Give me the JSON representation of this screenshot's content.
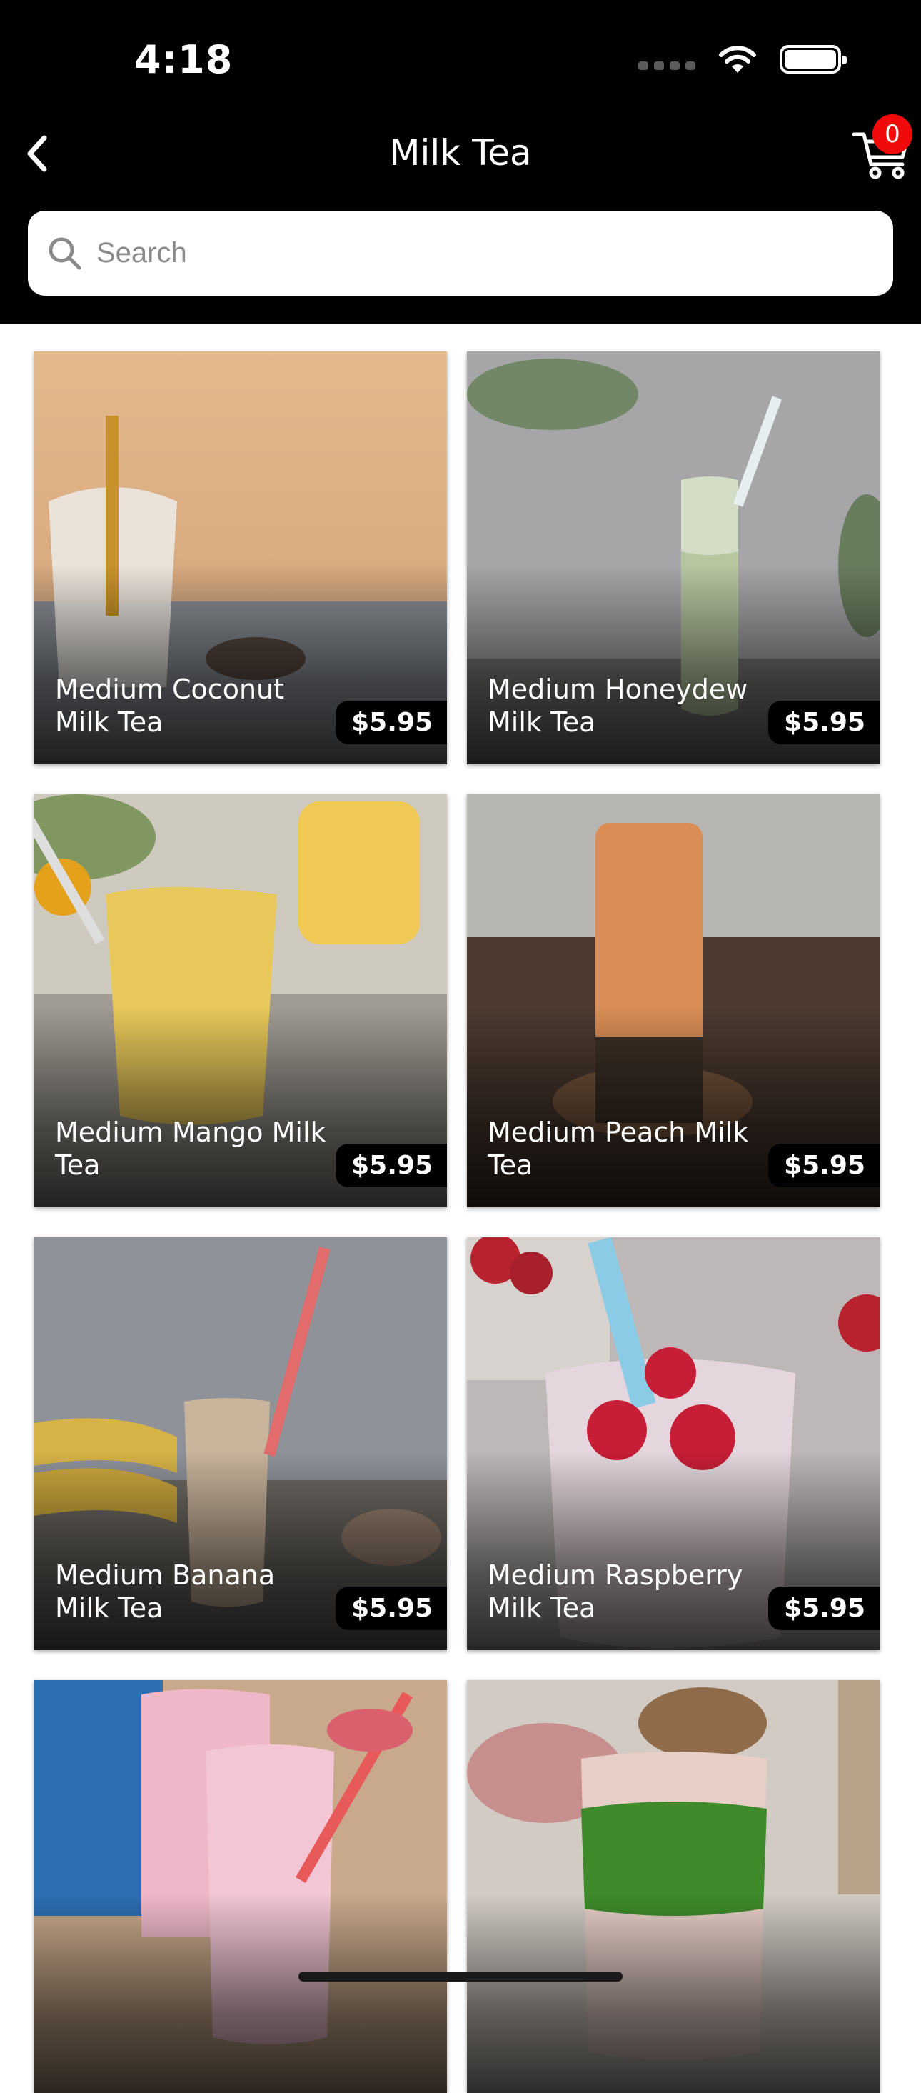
{
  "status_bar": {
    "time": "4:18"
  },
  "nav": {
    "title": "Milk Tea",
    "cart_count": "0"
  },
  "search": {
    "placeholder": "Search"
  },
  "products": [
    {
      "name": "Medium Coconut Milk Tea",
      "price": "$5.95"
    },
    {
      "name": "Medium Honeydew Milk Tea",
      "price": "$5.95"
    },
    {
      "name": "Medium Mango Milk Tea",
      "price": "$5.95"
    },
    {
      "name": "Medium Peach Milk Tea",
      "price": "$5.95"
    },
    {
      "name": "Medium Banana Milk Tea",
      "price": "$5.95"
    },
    {
      "name": "Medium Raspberry Milk Tea",
      "price": "$5.95"
    },
    {
      "name": "",
      "price": ""
    },
    {
      "name": "",
      "price": ""
    }
  ],
  "colors": {
    "header_bg": "#000000",
    "badge": "#f00a0a",
    "price_bg": "#000000"
  },
  "icons": {
    "back": "chevron-left-icon",
    "cart": "cart-icon",
    "search": "search-icon"
  }
}
